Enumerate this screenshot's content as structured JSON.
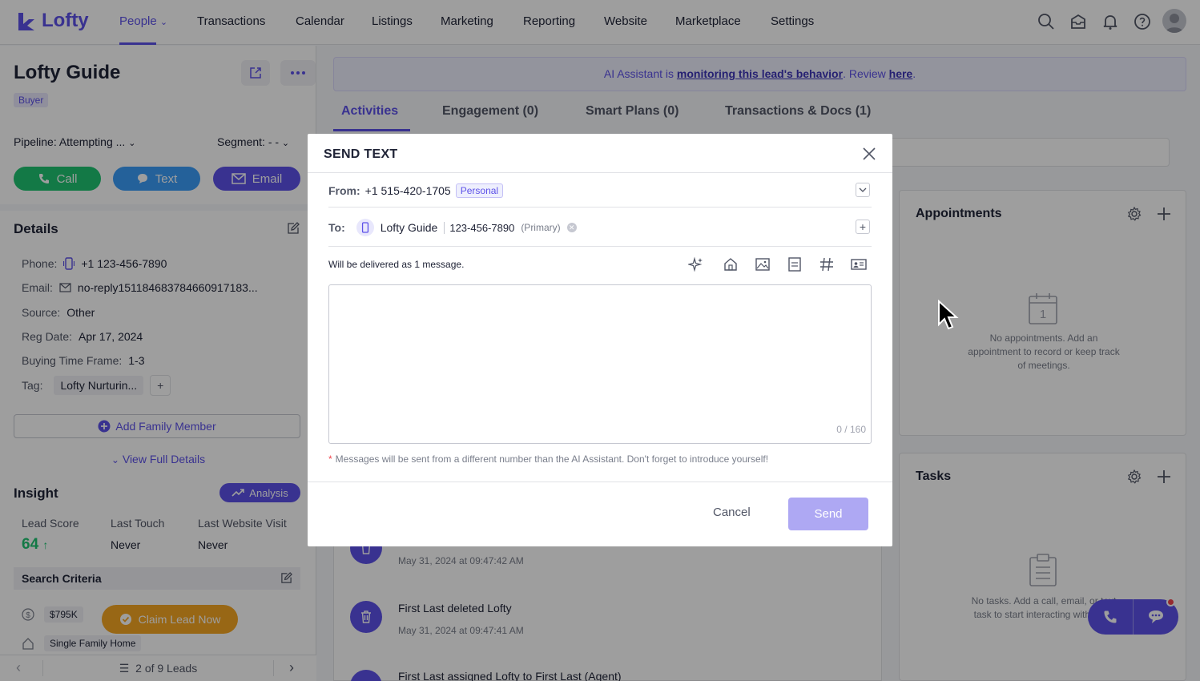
{
  "brand": {
    "name": "Lofty",
    "accent": "#5d51e8"
  },
  "nav": {
    "items": [
      "People",
      "Transactions",
      "Calendar",
      "Listings",
      "Marketing",
      "Reporting",
      "Website",
      "Marketplace",
      "Settings"
    ],
    "active": "People"
  },
  "lead": {
    "name": "Lofty Guide",
    "role": "Buyer",
    "pipeline": "Pipeline:  Attempting ...",
    "segment": "Segment: - -",
    "actions": {
      "call": "Call",
      "text": "Text",
      "email": "Email"
    }
  },
  "details": {
    "title": "Details",
    "phone_label": "Phone:",
    "phone": "+1 123-456-7890",
    "email_label": "Email:",
    "email": "no-reply151184683784660917183...",
    "source_label": "Source:",
    "source": "Other",
    "reg_label": "Reg Date:",
    "reg": "Apr 17, 2024",
    "timeframe_label": "Buying Time Frame:",
    "timeframe": "1-3",
    "tag_label": "Tag:",
    "tag": "Lofty Nurturin...",
    "add_family": "Add Family Member",
    "view_full": "View Full Details"
  },
  "insight": {
    "title": "Insight",
    "analysis": "Analysis",
    "lead_score_label": "Lead Score",
    "lead_score": "64",
    "last_touch_label": "Last Touch",
    "last_touch": "Never",
    "last_visit_label": "Last Website Visit",
    "last_visit": "Never",
    "criteria_title": "Search Criteria",
    "price": "$795K",
    "home_type": "Single Family Home",
    "claim": "Claim Lead Now"
  },
  "pager": {
    "text": "2 of 9 Leads"
  },
  "banner": {
    "prefix": "AI Assistant is ",
    "link1": "monitoring this lead's behavior",
    "middle": ". Review ",
    "link2": "here",
    "suffix": "."
  },
  "tabs": [
    "Activities",
    "Engagement (0)",
    "Smart Plans (0)",
    "Transactions & Docs (1)"
  ],
  "activities": [
    {
      "title": "",
      "time": "May 31, 2024 at 09:47:42 AM"
    },
    {
      "title": "First Last deleted Lofty",
      "time": "May 31, 2024 at 09:47:41 AM"
    },
    {
      "title": "First Last assigned Lofty to First Last (Agent)",
      "time": ""
    }
  ],
  "appointments": {
    "title": "Appointments",
    "empty": "No appointments. Add an appointment to record or keep track of meetings.",
    "calendar_day": "1"
  },
  "tasks": {
    "title": "Tasks",
    "empty": "No tasks. Add a call, email, or text task to start interacting with lead."
  },
  "modal": {
    "title": "SEND TEXT",
    "from_label": "From:",
    "from_number": "+1 515-420-1705",
    "from_badge": "Personal",
    "to_label": "To:",
    "to_name": "Lofty Guide",
    "to_phone": "123-456-7890",
    "to_primary": "(Primary)",
    "delivered": "Will be delivered as 1 message.",
    "message_value": "",
    "counter": "0 / 160",
    "notice": "Messages will be sent from a different number than the AI Assistant. Don't forget to introduce yourself!",
    "cancel": "Cancel",
    "send": "Send"
  }
}
